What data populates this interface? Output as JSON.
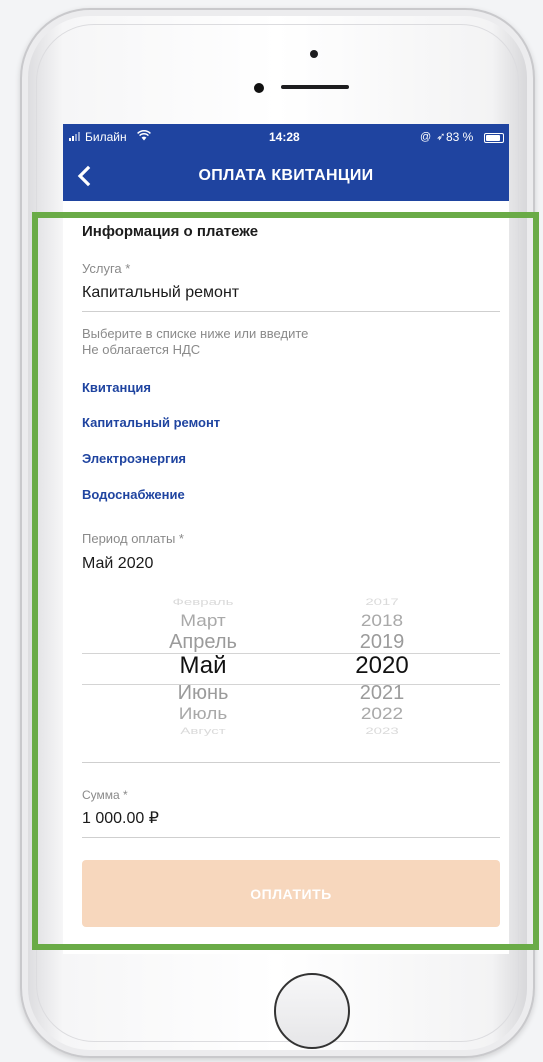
{
  "status_bar": {
    "carrier": "Билайн",
    "wifi_icon": "ᯓ",
    "time": "14:28",
    "icons": "@ ➶",
    "battery": "83 %"
  },
  "header": {
    "back_icon": "chevron-left-icon",
    "title": "ОПЛАТА КВИТАНЦИИ",
    "background": "#1f44a0"
  },
  "section": {
    "title": "Информация о платеже"
  },
  "service": {
    "label": "Услуга *",
    "value": "Капитальный ремонт",
    "hint_line1": "Выберите в списке ниже или введите",
    "hint_line2": "Не облагается НДС",
    "suggestions": [
      "Квитанция",
      "Капитальный ремонт",
      "Электроэнергия",
      "Водоснабжение"
    ],
    "suggestion_color": "#1f44a0"
  },
  "period": {
    "label": "Период оплаты *",
    "value": "Май 2020",
    "months": [
      "Февраль",
      "Март",
      "Апрель",
      "Май",
      "Июнь",
      "Июль",
      "Август"
    ],
    "years": [
      "2017",
      "2018",
      "2019",
      "2020",
      "2021",
      "2022",
      "2023"
    ],
    "selected_month": "Май",
    "selected_year": "2020"
  },
  "amount": {
    "label": "Сумма *",
    "value": "1 000.00 ₽"
  },
  "pay_button": {
    "label": "ОПЛАТИТЬ",
    "color": "#f7d7bd"
  },
  "highlight_color": "#6aab47"
}
